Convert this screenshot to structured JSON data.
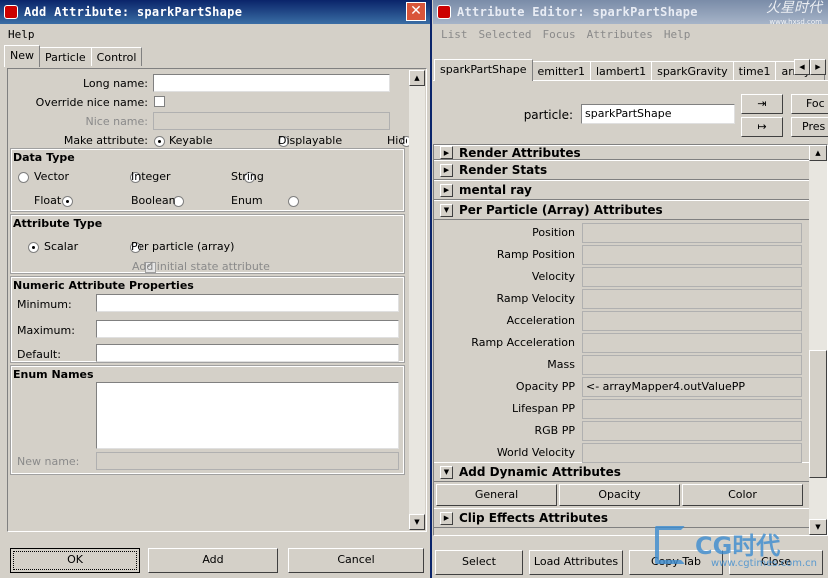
{
  "add_attr": {
    "title": "Add Attribute: sparkPartShape",
    "menu": [
      "Help"
    ],
    "tabs": [
      "New",
      "Particle",
      "Control"
    ],
    "form": {
      "long_name_label": "Long name:",
      "override_label": "Override nice name:",
      "nice_name_label": "Nice name:",
      "make_attr_label": "Make attribute:",
      "keyable": "Keyable",
      "displayable": "Displayable",
      "hidden": "Hidd"
    },
    "data_type": {
      "title": "Data Type",
      "options": [
        "Vector",
        "Integer",
        "String",
        "Float",
        "Boolean",
        "Enum"
      ],
      "selected": "Float"
    },
    "attribute_type": {
      "title": "Attribute Type",
      "scalar": "Scalar",
      "per_particle": "Per particle (array)",
      "initial_state": "Add initial state attribute"
    },
    "numeric": {
      "title": "Numeric Attribute Properties",
      "minimum": "Minimum:",
      "maximum": "Maximum:",
      "default": "Default:"
    },
    "enum": {
      "title": "Enum Names",
      "new_name": "New name:"
    },
    "buttons": {
      "ok": "OK",
      "add": "Add",
      "cancel": "Cancel"
    }
  },
  "attr_editor": {
    "title": "Attribute Editor: sparkPartShape",
    "menu": [
      "List",
      "Selected",
      "Focus",
      "Attributes",
      "Help"
    ],
    "tabs": [
      "sparkPartShape",
      "emitter1",
      "lambert1",
      "sparkGravity",
      "time1",
      "arrayMap"
    ],
    "particle_label": "particle:",
    "particle_value": "sparkPartShape",
    "focus_label": "Foc",
    "presets_label": "Pres",
    "sections": {
      "render_attributes": "Render Attributes",
      "render_stats": "Render Stats",
      "mental_ray": "mental ray",
      "per_particle": "Per Particle (Array) Attributes",
      "add_dynamic": "Add Dynamic Attributes",
      "clip_effects": "Clip Effects Attributes"
    },
    "pp_rows": [
      {
        "label": "Position",
        "value": ""
      },
      {
        "label": "Ramp Position",
        "value": ""
      },
      {
        "label": "Velocity",
        "value": ""
      },
      {
        "label": "Ramp Velocity",
        "value": ""
      },
      {
        "label": "Acceleration",
        "value": ""
      },
      {
        "label": "Ramp Acceleration",
        "value": ""
      },
      {
        "label": "Mass",
        "value": ""
      },
      {
        "label": "Opacity PP",
        "value": "<- arrayMapper4.outValuePP"
      },
      {
        "label": "Lifespan PP",
        "value": ""
      },
      {
        "label": "RGB PP",
        "value": ""
      },
      {
        "label": "World Velocity",
        "value": ""
      }
    ],
    "dynamic_buttons": [
      "General",
      "Opacity",
      "Color"
    ],
    "bottom_buttons": [
      "Select",
      "Load Attributes",
      "Copy Tab",
      "Close"
    ]
  },
  "watermark": {
    "top_right": "火星时代",
    "top_right_url": "www.hxsd.com",
    "logo_text": "CG时代",
    "logo_url": "www.cgtimes.com.cn"
  }
}
